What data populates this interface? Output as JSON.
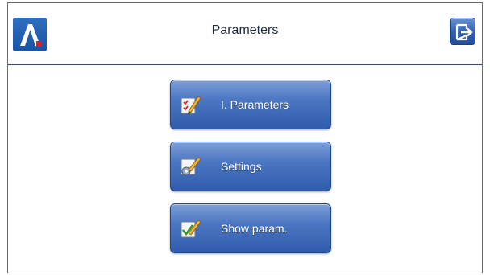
{
  "header": {
    "title": "Parameters",
    "logo_letter": "A",
    "exit_icon": "exit-icon"
  },
  "menu": {
    "items": [
      {
        "label": "I. Parameters",
        "icon": "checklist-pencil-icon"
      },
      {
        "label": "Settings",
        "icon": "settings-pencil-icon"
      },
      {
        "label": "Show param.",
        "icon": "checkmark-pencil-icon"
      }
    ]
  },
  "colors": {
    "accent_blue": "#2f5cab",
    "header_line": "#3c4b6a",
    "logo_red": "#d8202a"
  }
}
